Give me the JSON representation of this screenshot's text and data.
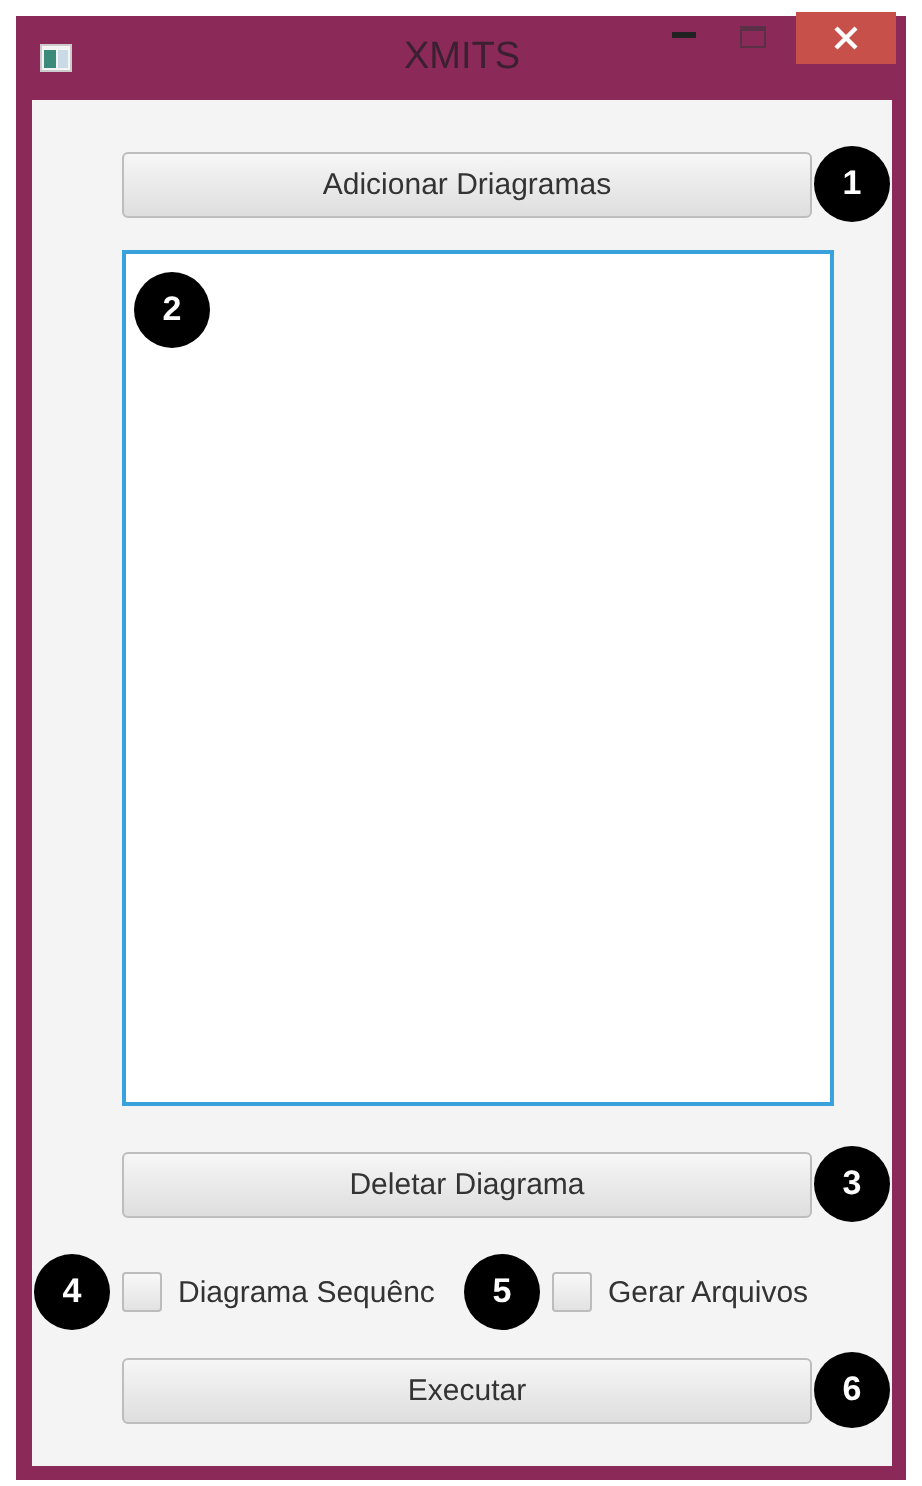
{
  "window": {
    "title": "XMITS"
  },
  "add_button": {
    "label": "Adicionar Driagramas",
    "marker": "1"
  },
  "diagram_list": {
    "marker": "2"
  },
  "delete_button": {
    "label": "Deletar Diagrama",
    "marker": "3"
  },
  "checkboxes": [
    {
      "label": "Diagrama Sequênc",
      "checked": false,
      "marker": "4"
    },
    {
      "label": "Gerar Arquivos",
      "checked": false,
      "marker": "5"
    }
  ],
  "run_button": {
    "label": "Executar",
    "marker": "6"
  }
}
